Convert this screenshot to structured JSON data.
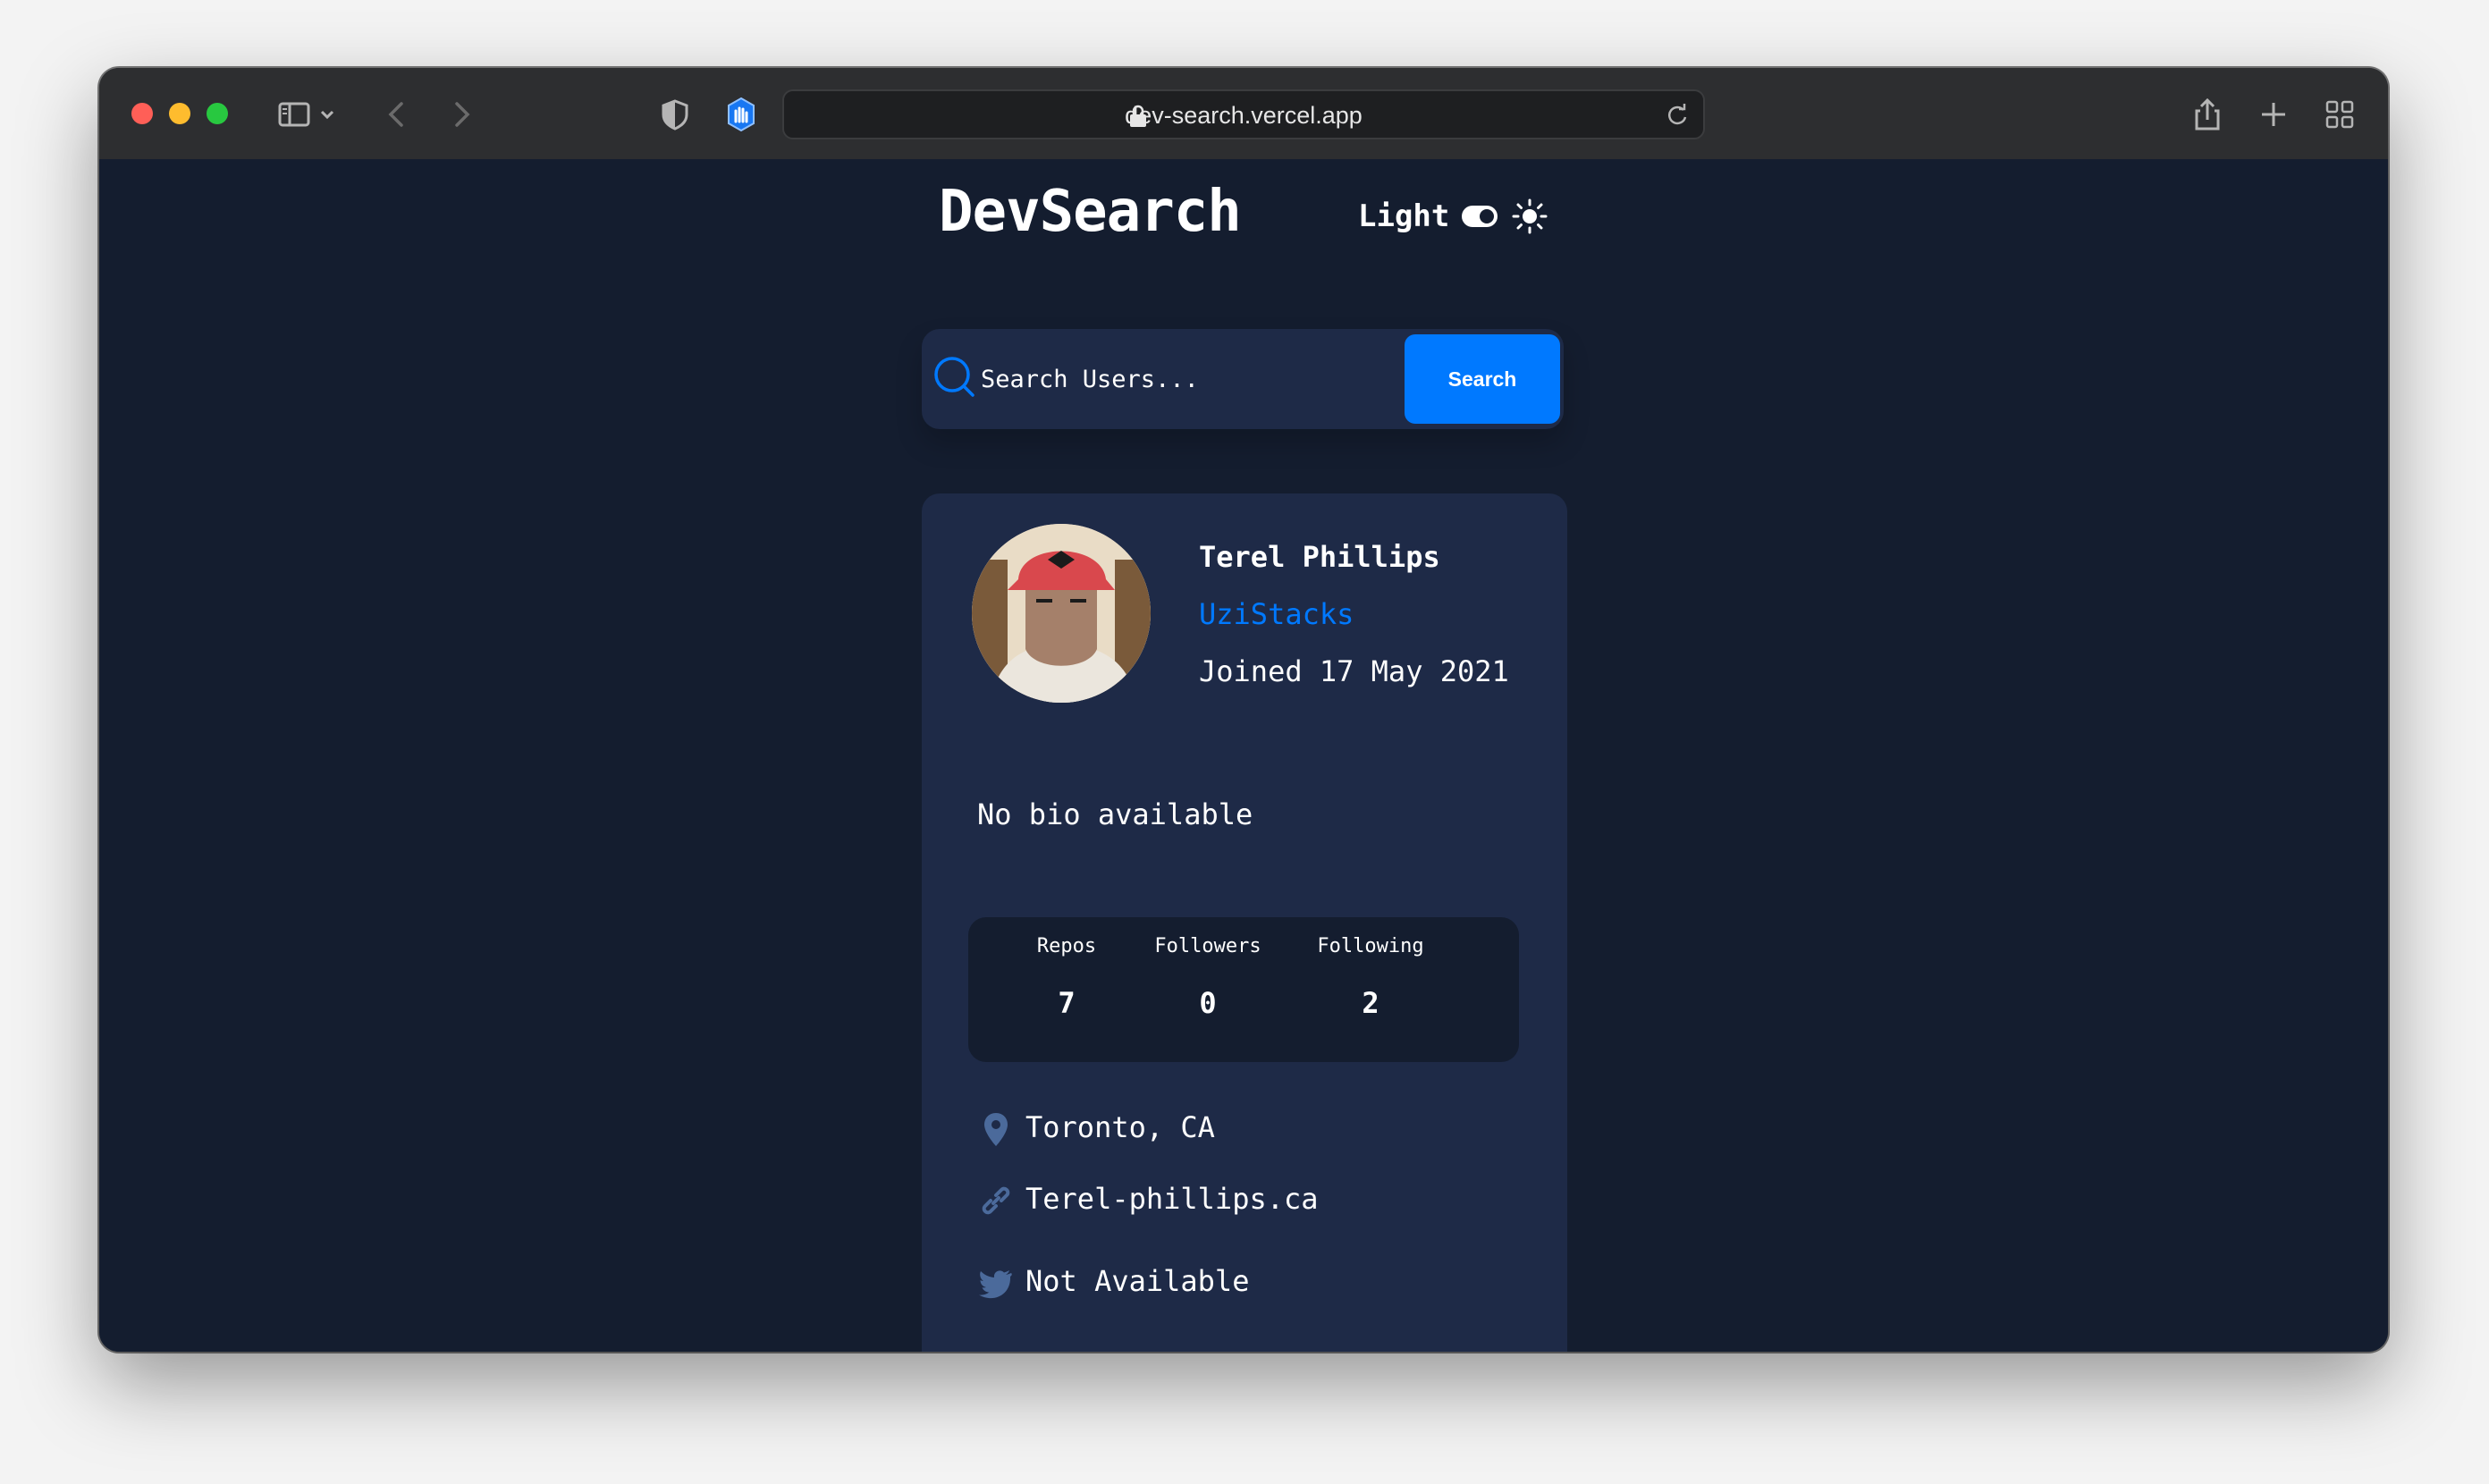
{
  "browser": {
    "url": "dev-search.vercel.app",
    "colors": {
      "close": "#ff5f57",
      "minimize": "#febc2e",
      "zoom": "#28c840"
    }
  },
  "app": {
    "title": "DevSearch",
    "theme_label": "Light",
    "search": {
      "placeholder": "Search Users...",
      "button_label": "Search"
    },
    "accent": "#0079ff",
    "background": "#141d2f",
    "card_color": "#1e2a47"
  },
  "profile": {
    "name": "Terel Phillips",
    "login": "UziStacks",
    "joined": "Joined 17 May 2021",
    "bio": "No bio available",
    "stats": [
      {
        "label": "Repos",
        "value": "7"
      },
      {
        "label": "Followers",
        "value": "0"
      },
      {
        "label": "Following",
        "value": "2"
      }
    ],
    "location": "Toronto, CA",
    "website": "Terel-phillips.ca",
    "twitter": "Not Available"
  }
}
